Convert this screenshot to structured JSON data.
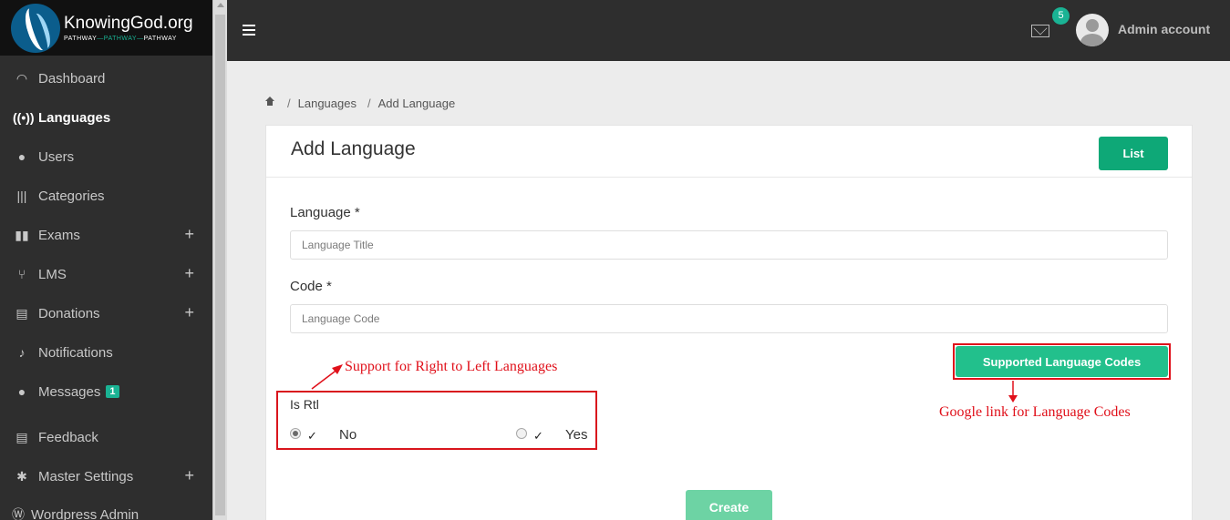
{
  "brand": {
    "title": "KnowingGod.org",
    "tagline_start": "PATHWAY",
    "tagline_mid": "—PATHWAY—",
    "tagline_end": "PATHWAY"
  },
  "sidebar": {
    "items": [
      {
        "label": "Dashboard",
        "icon": "gauge-icon",
        "active": false,
        "expandable": false
      },
      {
        "label": "Languages",
        "icon": "broadcast-icon",
        "active": true,
        "expandable": false
      },
      {
        "label": "Users",
        "icon": "user-icon",
        "active": false,
        "expandable": false
      },
      {
        "label": "Categories",
        "icon": "bars-icon",
        "active": false,
        "expandable": false
      },
      {
        "label": "Exams",
        "icon": "book-icon",
        "active": false,
        "expandable": true
      },
      {
        "label": "LMS",
        "icon": "fork-icon",
        "active": false,
        "expandable": true
      },
      {
        "label": "Donations",
        "icon": "file-icon",
        "active": false,
        "expandable": true
      },
      {
        "label": "Notifications",
        "icon": "bell-icon",
        "active": false,
        "expandable": false
      },
      {
        "label": "Messages",
        "icon": "chat-icon",
        "active": false,
        "expandable": false,
        "badge": "1"
      },
      {
        "label": "Feedback",
        "icon": "list-icon",
        "active": false,
        "expandable": false
      },
      {
        "label": "Master Settings",
        "icon": "gear-icon",
        "active": false,
        "expandable": true
      },
      {
        "label": "Wordpress Admin",
        "icon": "wordpress-icon",
        "active": false,
        "expandable": false
      }
    ],
    "plus_symbol": "+"
  },
  "topbar": {
    "mail_count": "5",
    "account_name": "Admin account"
  },
  "breadcrumb": {
    "separator": "/",
    "items": [
      "Languages",
      "Add Language"
    ]
  },
  "form": {
    "title": "Add Language",
    "list_button": "List",
    "language_label": "Language *",
    "language_placeholder": "Language Title",
    "code_label": "Code *",
    "code_placeholder": "Language Code",
    "codes_button": "Supported Language Codes",
    "rtl_label": "Is Rtl",
    "rtl_options": [
      {
        "label": "No",
        "checked": true
      },
      {
        "label": "Yes",
        "checked": false
      }
    ],
    "check_mark": "✓",
    "create_button": "Create"
  },
  "annotations": {
    "rtl_note": "Support for Right to Left Languages",
    "codes_note": "Google link for Language Codes",
    "color": "#e0101a"
  },
  "colors": {
    "accent": "#0ea877",
    "sidebar_bg": "#2e2e2e"
  }
}
